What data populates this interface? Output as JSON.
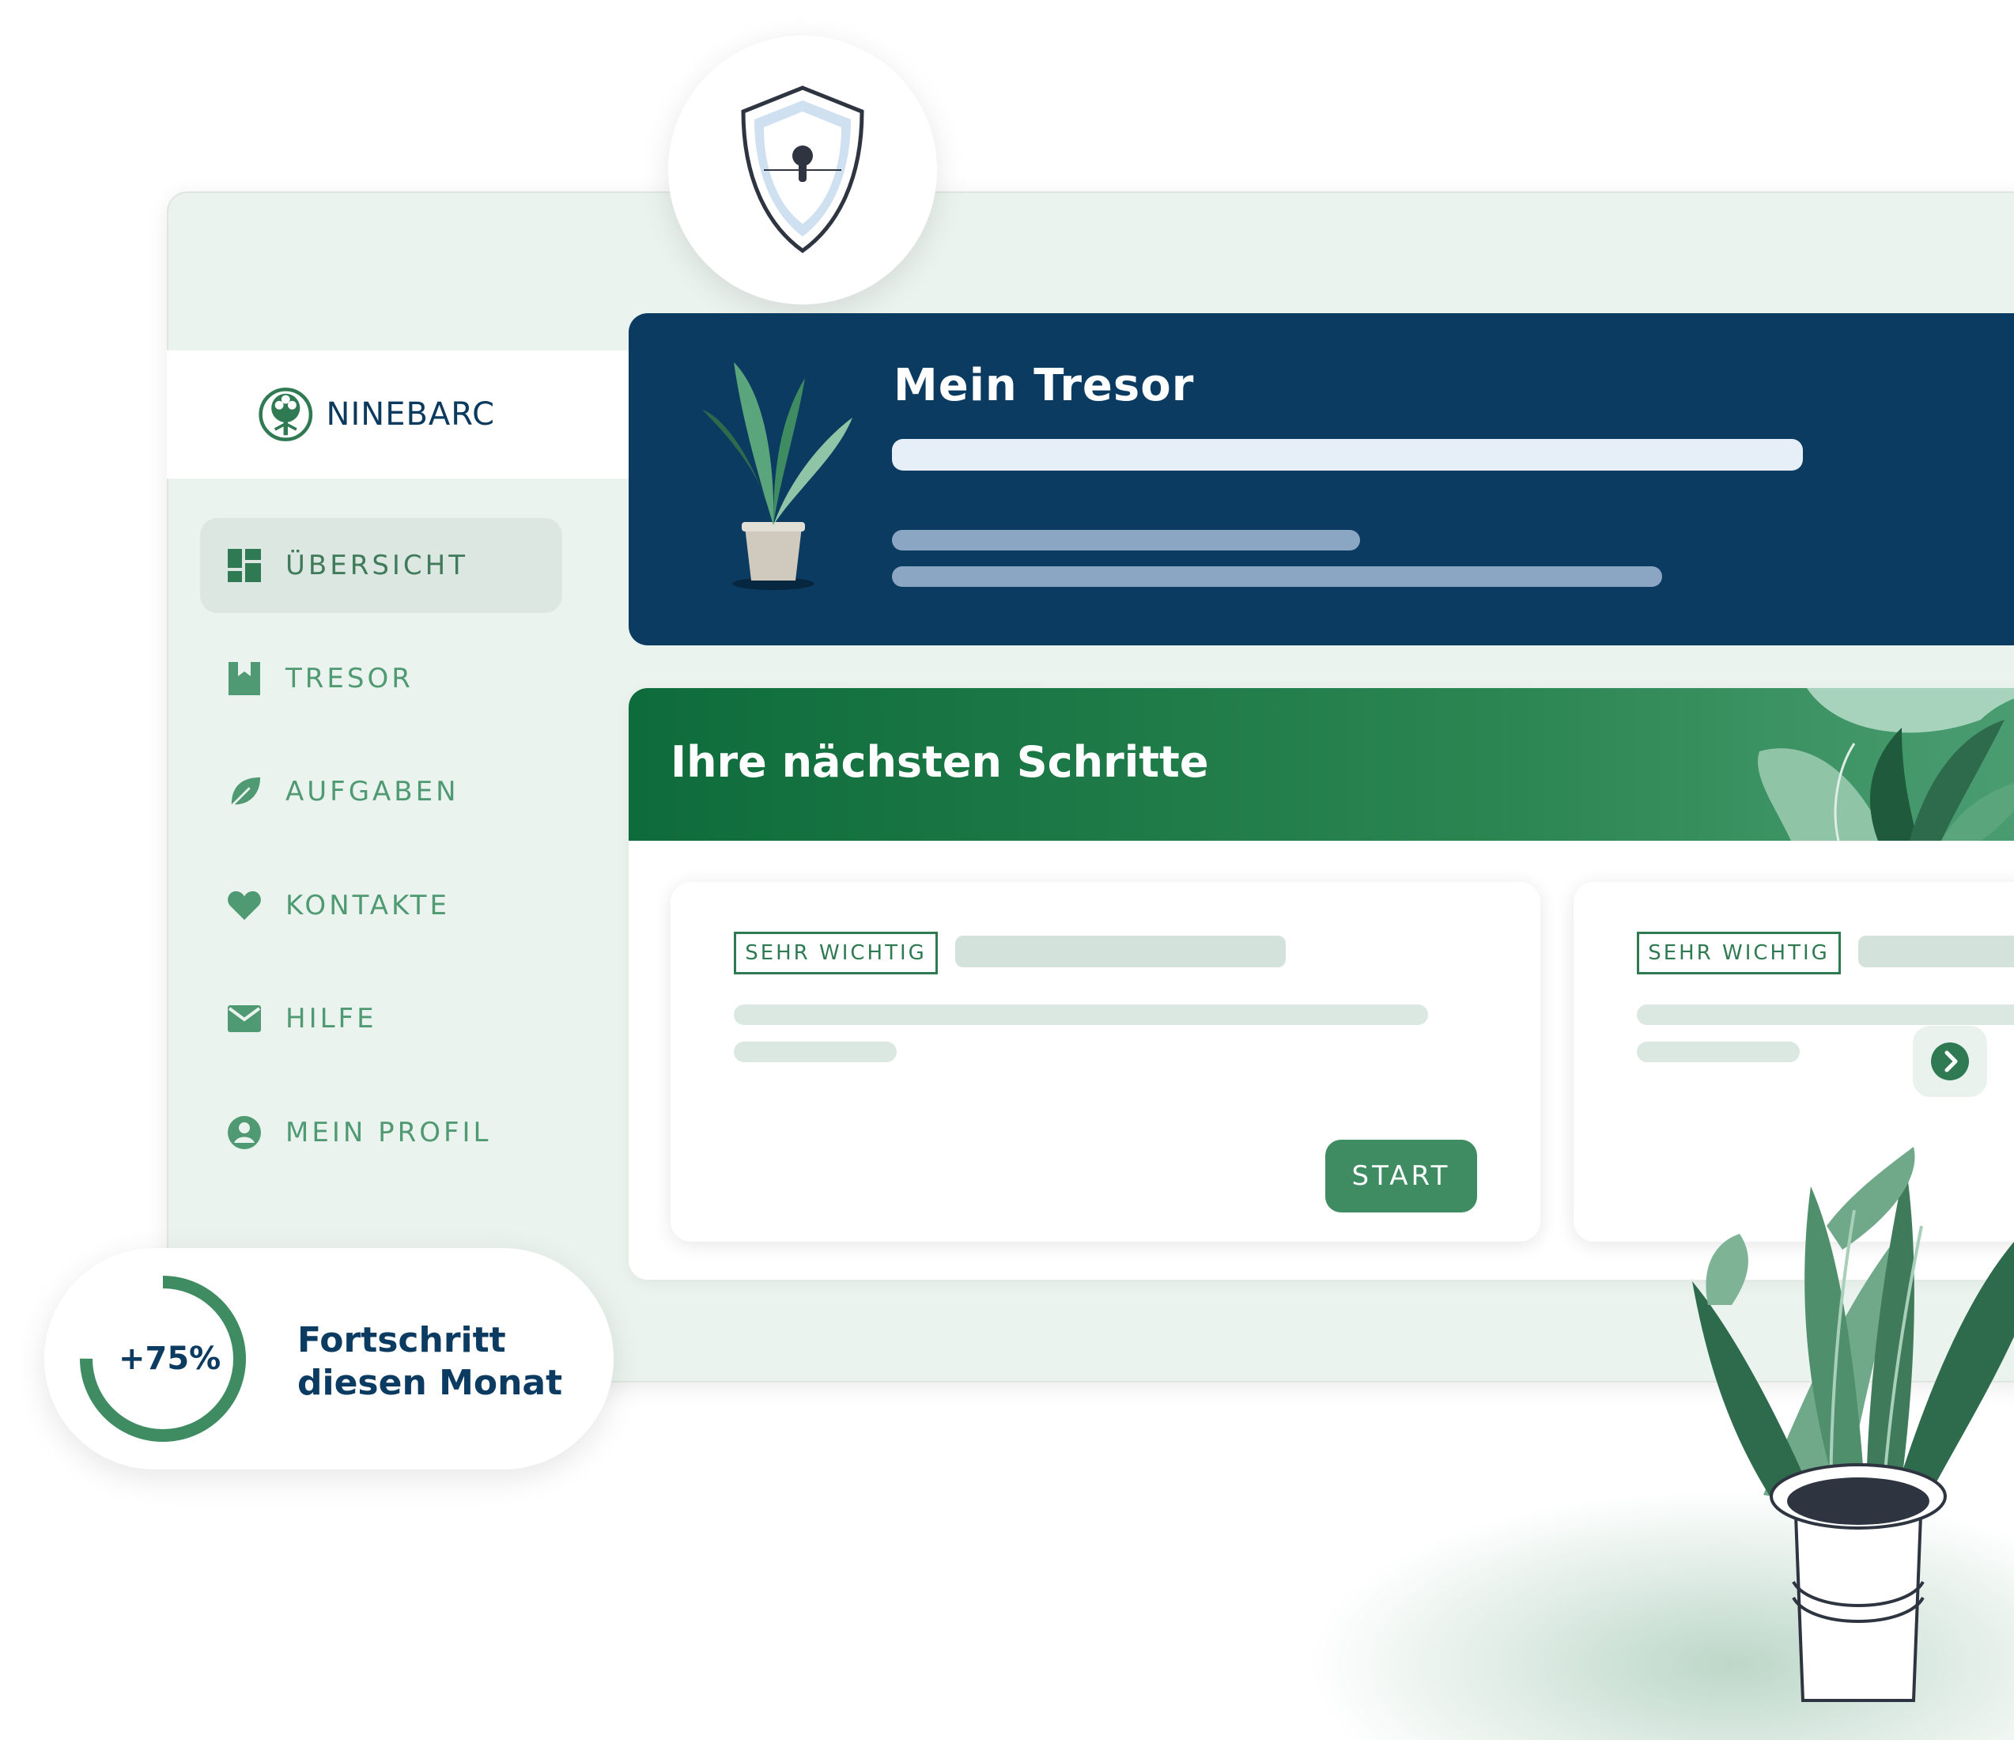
{
  "brand": {
    "name": "NINEBARC"
  },
  "sidebar": {
    "items": [
      {
        "label": "ÜBERSICHT",
        "icon": "dashboard-icon",
        "active": true
      },
      {
        "label": "TRESOR",
        "icon": "bookmark-icon",
        "active": false
      },
      {
        "label": "AUFGABEN",
        "icon": "leaf-icon",
        "active": false
      },
      {
        "label": "KONTAKTE",
        "icon": "heart-icon",
        "active": false
      },
      {
        "label": "HILFE",
        "icon": "envelope-icon",
        "active": false
      },
      {
        "label": "MEIN PROFIL",
        "icon": "user-icon",
        "active": false
      }
    ]
  },
  "tresor": {
    "title": "Mein Tresor"
  },
  "steps": {
    "title": "Ihre nächsten Schritte",
    "cards": [
      {
        "tag": "SEHR WICHTIG",
        "button": "START"
      },
      {
        "tag": "SEHR WICHTIG"
      }
    ]
  },
  "progress": {
    "value": "+75%",
    "fraction": 0.75,
    "label": "Fortschritt diesen Monat"
  },
  "colors": {
    "navy": "#0c3b62",
    "green": "#3f8c62",
    "sidebar_bg": "#ebf3ef",
    "accent_light": "#dce7e1"
  }
}
